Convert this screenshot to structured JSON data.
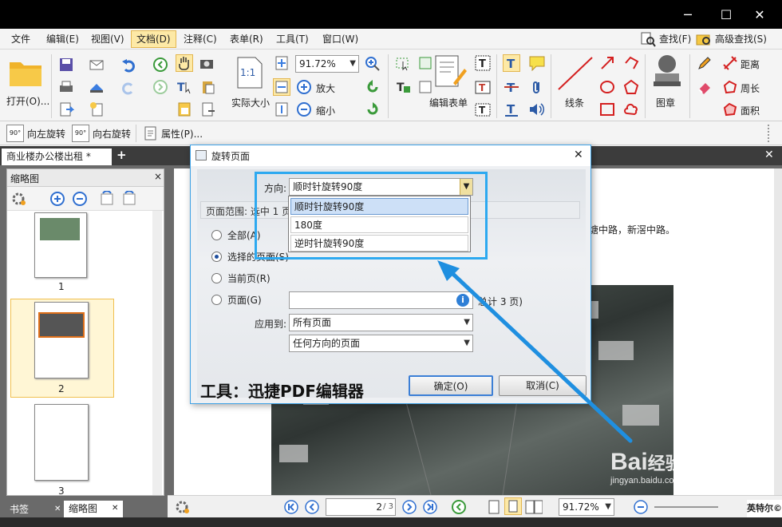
{
  "window": {
    "minimize": "─",
    "maximize": "☐",
    "close": "✕"
  },
  "menu": {
    "items": [
      "文件",
      "编辑(E)",
      "视图(V)",
      "文档(D)",
      "注释(C)",
      "表单(R)",
      "工具(T)",
      "窗口(W)"
    ],
    "right": {
      "find": "查找(F)",
      "advanced_find": "高级查找(S)"
    }
  },
  "ribbon": {
    "open": "打开(O)...",
    "zoom": "91.72%",
    "actual_size": "实际大小",
    "zoom_in": "放大",
    "zoom_out": "缩小",
    "actual_size_glyph": "1:1",
    "edit_form": "编辑表单",
    "lines": "线条",
    "stamp": "图章",
    "distance": "距离",
    "perimeter": "周长",
    "area": "面积"
  },
  "toolbar2": {
    "rotate_left": "向左旋转",
    "rotate_right": "向右旋转",
    "properties": "属性(P)...",
    "rot_icon": "90°"
  },
  "tabs": {
    "document": "商业楼办公楼出租 *",
    "add": "+",
    "close": "✕"
  },
  "thumbs": {
    "title": "缩略图",
    "pages": [
      "1",
      "2",
      "3"
    ],
    "close": "×"
  },
  "bottom_tabs": {
    "bookmarks": "书签",
    "thumbnails": "缩略图",
    "close": "✕"
  },
  "doc": {
    "text_right": "塘中路，新滘中路。"
  },
  "status": {
    "page_value": "2",
    "page_total": "/ 3",
    "zoom": "91.72%",
    "ime": "英特尔©"
  },
  "dialog": {
    "title": "旋转页面",
    "direction_label": "方向:",
    "direction_value": "顺时针旋转90度",
    "options": [
      "顺时针旋转90度",
      "180度",
      "逆时针旋转90度"
    ],
    "range_label": "页面范围: 选中 1 页",
    "radio_all": "全部(A)",
    "radio_selected": "选择的页面(S)",
    "radio_current": "当前页(R)",
    "radio_pages": "页面(G)",
    "total": "总计 3 页)",
    "apply_label": "应用到:",
    "apply_value": "所有页面",
    "orientation_value": "任何方向的页面",
    "caption": "工具：迅捷PDF编辑器",
    "ok": "确定(O)",
    "cancel": "取消(C)",
    "close": "✕"
  },
  "watermark": {
    "text": "Bai",
    "text2": "经验",
    "url": "jingyan.baidu.com"
  },
  "colors": {
    "accent": "#2da9f0",
    "menu_active": "#fde9a6",
    "titlebar": "#000000"
  }
}
